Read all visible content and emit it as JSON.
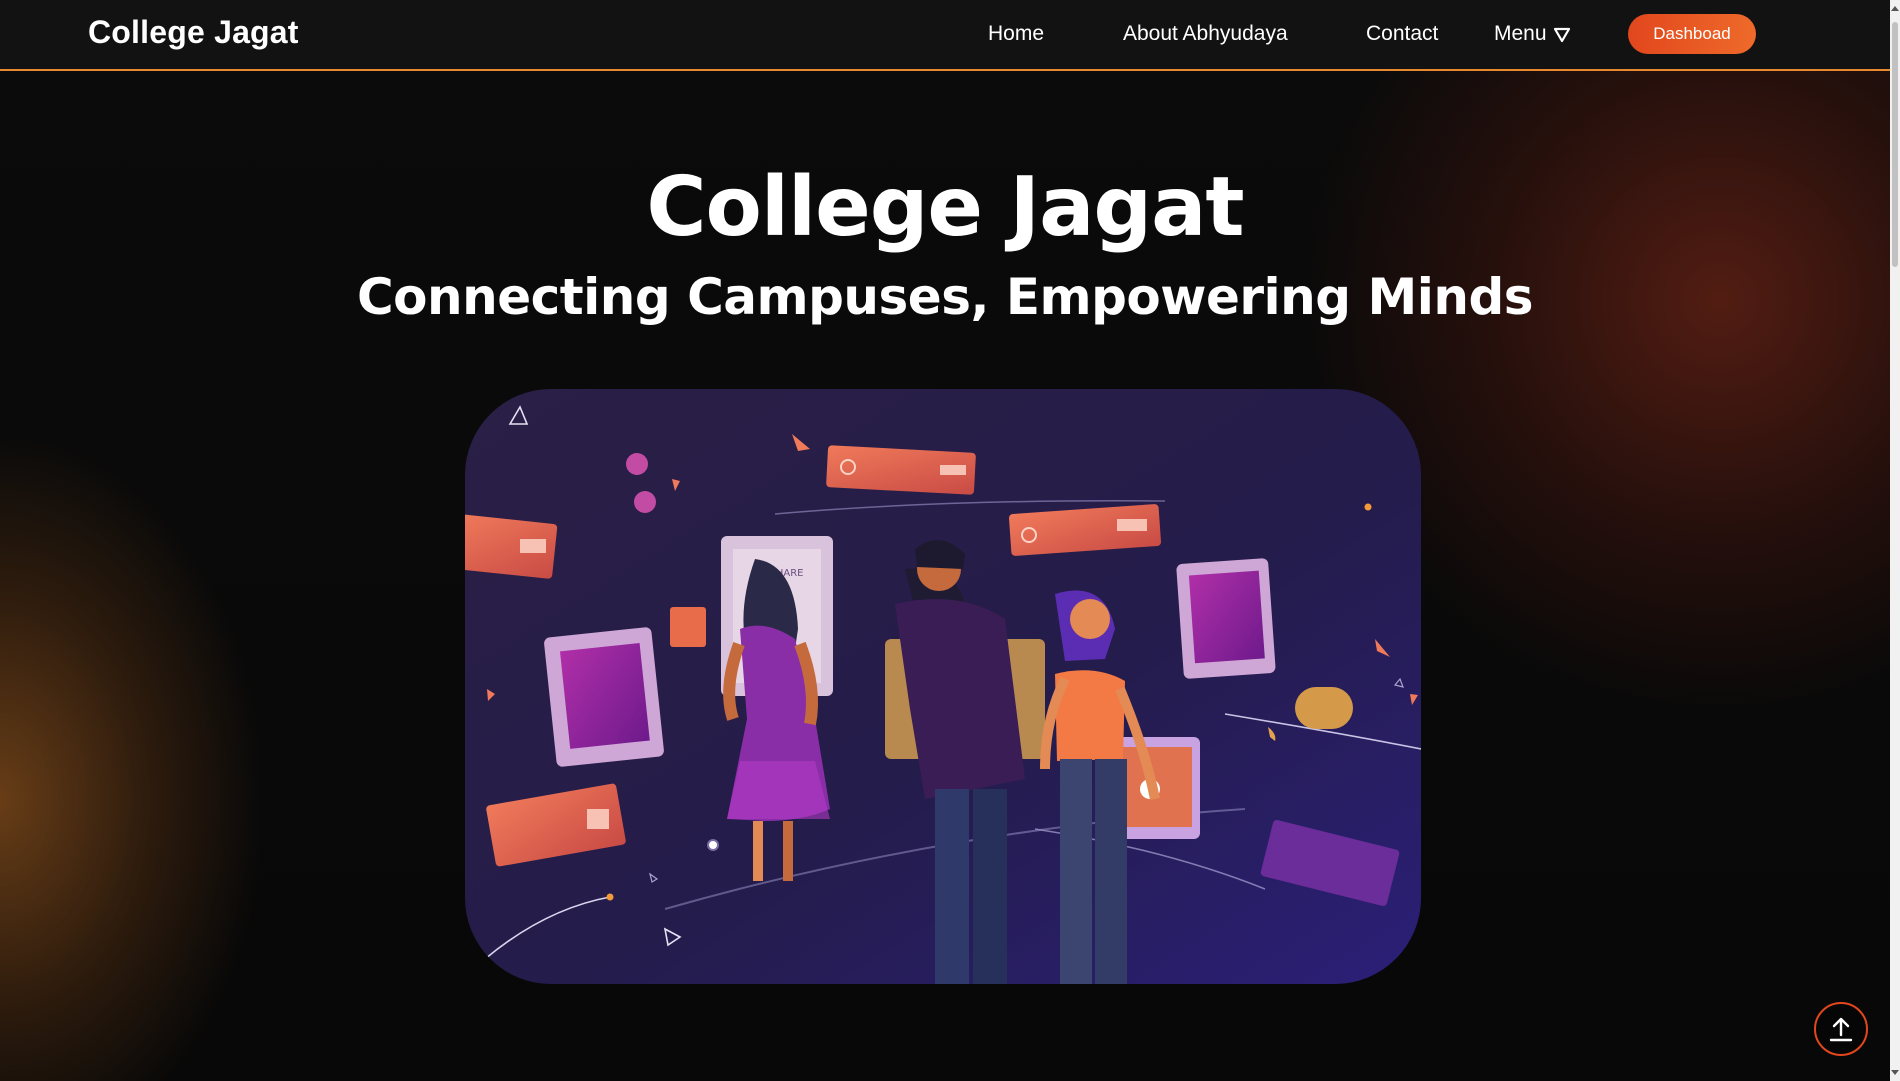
{
  "navbar": {
    "brand": "College Jagat",
    "links": [
      {
        "label": "Home"
      },
      {
        "label": "About Abhyudaya"
      },
      {
        "label": "Contact"
      },
      {
        "label": "Menu"
      }
    ],
    "dashboard_button": "Dashboad",
    "accent_color": "#e8892f",
    "button_color": "#e6551f"
  },
  "hero": {
    "title": "College Jagat",
    "subtitle": "Connecting Campuses, Empowering Minds",
    "illustration_board_text": "AIP SHARE"
  },
  "icons": {
    "menu_dropdown": "triangle-down-icon",
    "back_to_top": "arrow-up-icon"
  }
}
